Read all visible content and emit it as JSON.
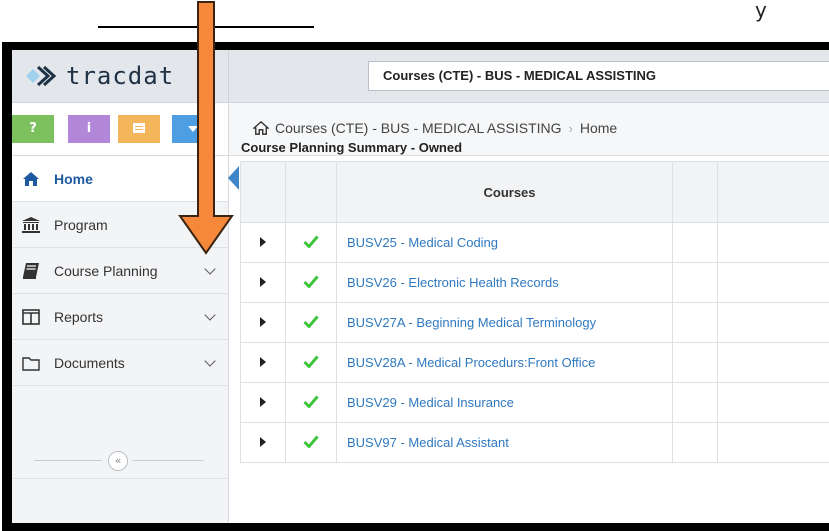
{
  "window_top": {
    "y_char": "y"
  },
  "header": {
    "logo_text": "tracdat",
    "course_selector": "Courses (CTE) - BUS - MEDICAL ASSISTING"
  },
  "toolbar": {
    "help_label": "?",
    "info_label": "i"
  },
  "sidebar": {
    "items": [
      {
        "label": "Home",
        "icon": "home-icon",
        "active": true
      },
      {
        "label": "Program",
        "icon": "bank-icon"
      },
      {
        "label": "Course Planning",
        "icon": "book-icon",
        "has_dropdown": true
      },
      {
        "label": "Reports",
        "icon": "columns-icon",
        "has_dropdown": true
      },
      {
        "label": "Documents",
        "icon": "folder-icon",
        "has_dropdown": true
      }
    ],
    "collapse_glyph": "«"
  },
  "breadcrumb": {
    "course": "Courses (CTE) - BUS - MEDICAL ASSISTING",
    "separator": "›",
    "page": "Home"
  },
  "summary": {
    "title": "Course Planning Summary - Owned",
    "columns": [
      "",
      "",
      "Courses",
      ""
    ],
    "rows": [
      {
        "course": "BUSV25 - Medical Coding",
        "status": "complete"
      },
      {
        "course": "BUSV26 - Electronic Health Records",
        "status": "complete"
      },
      {
        "course": "BUSV27A - Beginning Medical Terminology",
        "status": "complete"
      },
      {
        "course": "BUSV28A - Medical Procedurs:Front Office",
        "status": "complete"
      },
      {
        "course": "BUSV29 - Medical Insurance",
        "status": "complete"
      },
      {
        "course": "BUSV97 - Medical Assistant",
        "status": "complete"
      }
    ]
  },
  "colors": {
    "accent_blue": "#2f79c0",
    "check_green": "#3cc43c",
    "arrow_orange": "#f5883a"
  }
}
